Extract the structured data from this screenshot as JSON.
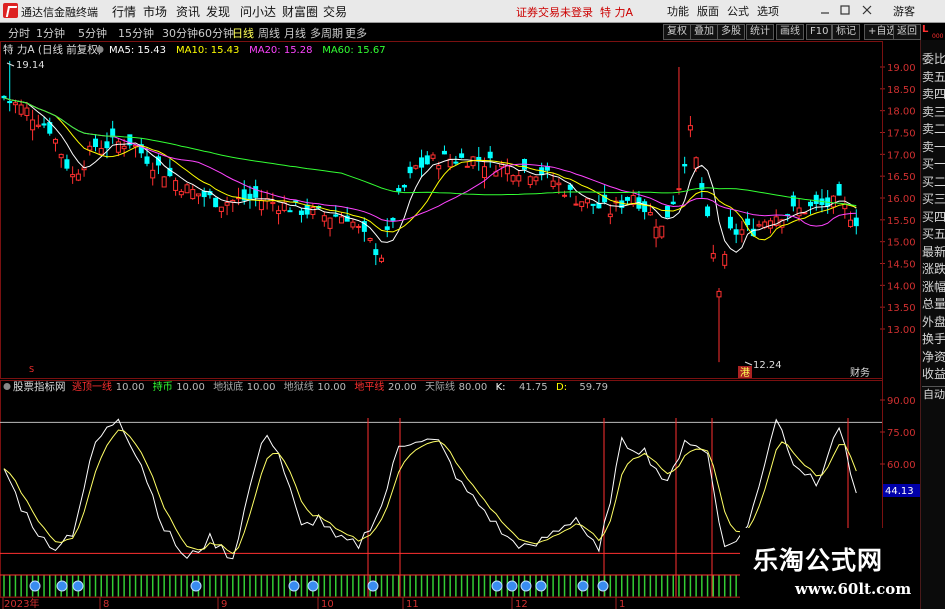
{
  "app": {
    "brand": "通达信金融终端",
    "status": "证券交易未登录",
    "stock_name": "特 力A"
  },
  "menu": [
    "行情",
    "市场",
    "资讯",
    "发现",
    "问小达",
    "财富圈",
    "交易"
  ],
  "topbar_right": [
    "功能",
    "版面",
    "公式",
    "选项",
    "游客"
  ],
  "periods": [
    {
      "label": "分时",
      "active": false
    },
    {
      "label": "1分钟",
      "active": false
    },
    {
      "label": "5分钟",
      "active": false
    },
    {
      "label": "15分钟",
      "active": false
    },
    {
      "label": "30分钟",
      "active": false
    },
    {
      "label": "60分钟",
      "active": false
    },
    {
      "label": "日线",
      "active": true
    },
    {
      "label": "周线",
      "active": false
    },
    {
      "label": "月线",
      "active": false
    },
    {
      "label": "多周期",
      "active": false
    },
    {
      "label": "更多",
      "active": false
    }
  ],
  "toolbar_right": [
    "复权",
    "叠加",
    "多股",
    "统计",
    "画线",
    "F10",
    "标记",
    "+自选",
    "返回"
  ],
  "corner": {
    "l": "L",
    "sub": "000"
  },
  "main_legend": {
    "title": "特 力A (日线 前复权)",
    "items": [
      {
        "label": "MA5: 15.43",
        "color": "#ffffff"
      },
      {
        "label": "MA10: 15.43",
        "color": "#ffff00"
      },
      {
        "label": "MA20: 15.28",
        "color": "#ff44ff"
      },
      {
        "label": "MA60: 15.67",
        "color": "#33ff33"
      }
    ]
  },
  "annotations": {
    "high": "19.14",
    "low": "12.24",
    "xian": "港",
    "caiwu": "财务"
  },
  "sub_legend": {
    "title": "股票指标网",
    "items": [
      {
        "label": "逃顶一线",
        "value": "10.00",
        "color": "#ff3030"
      },
      {
        "label": "持币",
        "value": "10.00",
        "color": "#33ff33"
      },
      {
        "label": "地狱底",
        "value": "10.00",
        "color": "#aaaaaa"
      },
      {
        "label": "地狱线",
        "value": "10.00",
        "color": "#aaaaaa"
      },
      {
        "label": "地平线",
        "value": "20.00",
        "color": "#ff3030"
      },
      {
        "label": "天际线",
        "value": "80.00",
        "color": "#aaaaaa"
      },
      {
        "label": "K:",
        "value": "41.75",
        "color": "#ffffff"
      },
      {
        "label": "D:",
        "value": "59.79",
        "color": "#ffff00"
      }
    ]
  },
  "price_axis": [
    "19.00",
    "18.50",
    "18.00",
    "17.50",
    "17.00",
    "16.50",
    "16.00",
    "15.50",
    "15.00",
    "14.50",
    "14.00",
    "13.50",
    "13.00"
  ],
  "sub_axis": [
    "90.00",
    "75.00",
    "60.00"
  ],
  "current_value": "44.13",
  "date_axis": [
    "2023年",
    "8",
    "9",
    "10",
    "11",
    "12",
    "1"
  ],
  "side_panel": [
    "委比",
    "卖五",
    "卖四",
    "卖三",
    "卖二",
    "卖一",
    "买一",
    "买二",
    "买三",
    "买四",
    "买五",
    "最新",
    "涨跌",
    "涨幅",
    "总量",
    "外盘",
    "换手",
    "净资",
    "收益"
  ],
  "side_bottom": "自动",
  "watermark": {
    "line1": "乐淘公式网",
    "line2": "www.60lt.com"
  },
  "colors": {
    "up": "#ff3030",
    "down": "#00ffff",
    "ma5": "#ffffff",
    "ma10": "#ffff00",
    "ma20": "#ff44ff",
    "ma60": "#33ff33",
    "grid": "#7a1010"
  }
}
